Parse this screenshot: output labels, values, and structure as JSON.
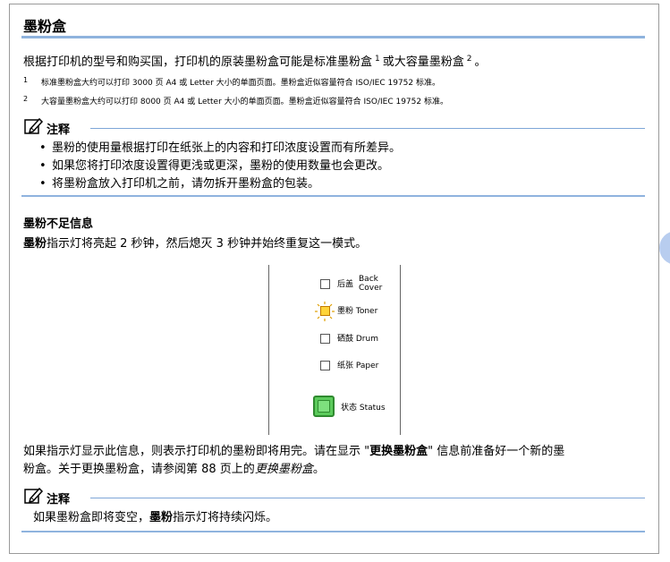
{
  "section": {
    "title": "墨粉盒"
  },
  "intro": {
    "text_before": "根据打印机的型号和购买国，打印机的原装墨粉盒可能是标准墨粉盒",
    "sup1": "1",
    "text_middle": "或大容量墨粉盒",
    "sup2": "2",
    "text_after": "。"
  },
  "footnotes": [
    {
      "num": "1",
      "text": "标准墨粉盒大约可以打印 3000 页 A4 或 Letter 大小的单面页面。墨粉盒近似容量符合 ISO/IEC 19752 标准。"
    },
    {
      "num": "2",
      "text": "大容量墨粉盒大约可以打印 8000 页 A4 或 Letter 大小的单面页面。墨粉盒近似容量符合 ISO/IEC 19752 标准。"
    }
  ],
  "note1": {
    "label": "注释",
    "bullets": [
      "墨粉的使用量根据打印在纸张上的内容和打印浓度设置而有所差异。",
      "如果您将打印浓度设置得更浅或更深，墨粉的使用数量也会更改。",
      "将墨粉盒放入打印机之前，请勿拆开墨粉盒的包装。"
    ]
  },
  "low_toner": {
    "title": "墨粉不足信息",
    "line_bold": "墨粉",
    "line_rest": "指示灯将亮起 2 秒钟，然后熄灭 3 秒钟并始终重复这一模式。"
  },
  "panel": {
    "back_cover_cn": "后盖",
    "back_cover_en_1": "Back",
    "back_cover_en_2": "Cover",
    "toner": "墨粉 Toner",
    "drum": "硒鼓 Drum",
    "paper": "纸张 Paper",
    "status": "状态 Status",
    "toner_led_color": "#ffd43b",
    "status_led_color": "#5ccb5c"
  },
  "after_panel": {
    "line1_a": "如果指示灯显示此信息，则表示打印机的墨粉即将用完。请在显示 \"",
    "line1_bold": "更换墨粉盒",
    "line1_b": "\" 信息前准备好一个新的墨",
    "line2_a": "粉盒。关于更换墨粉盒，请参阅第 88 页上的",
    "line2_ital": "更换墨粉盒",
    "line2_b": "。"
  },
  "note2": {
    "label": "注释",
    "text_a": "如果墨粉盒即将变空，",
    "text_bold": "墨粉",
    "text_b": "指示灯将持续闪烁。"
  },
  "colors": {
    "accent_rule": "#8fb3de",
    "note_rule": "#7ea6d8"
  }
}
